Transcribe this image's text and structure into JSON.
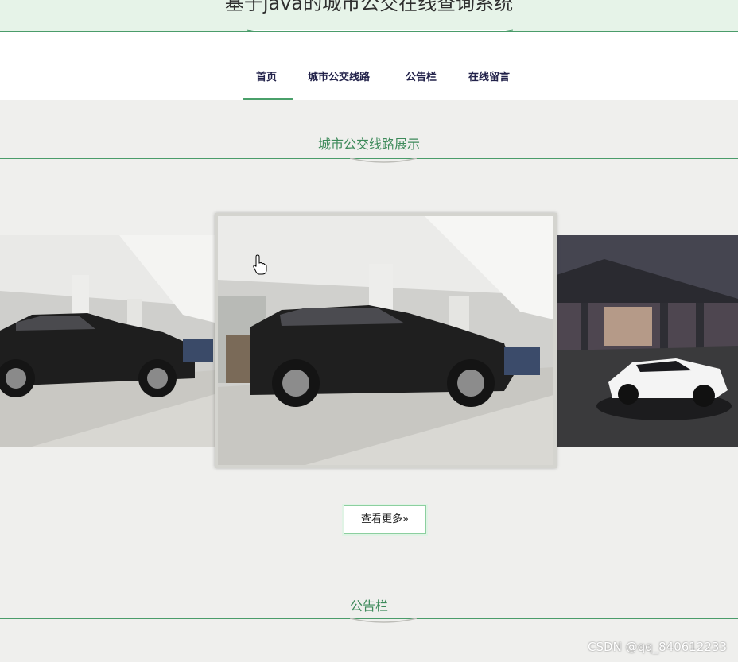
{
  "header": {
    "title": "基于java的城市公交在线查询系统"
  },
  "nav": {
    "items": [
      {
        "label": "首页",
        "active": true
      },
      {
        "label": "城市公交线路",
        "active": false
      },
      {
        "label": "公告栏",
        "active": false
      },
      {
        "label": "在线留言",
        "active": false
      }
    ]
  },
  "routes_section": {
    "title": "城市公交线路展示",
    "carousel": {
      "slides": [
        {
          "image": "black-suv-showroom-left"
        },
        {
          "image": "black-suv-showroom-center"
        },
        {
          "image": "white-sports-car-under-bridge"
        }
      ],
      "active_index": 1
    },
    "more_button": "查看更多»"
  },
  "notice_section": {
    "title": "公告栏"
  },
  "watermark": "CSDN @qq_840612233",
  "colors": {
    "accent_green": "#4a9c6a",
    "header_bg": "#e6f3e8",
    "page_bg": "#efefed",
    "nav_text": "#22224a"
  }
}
